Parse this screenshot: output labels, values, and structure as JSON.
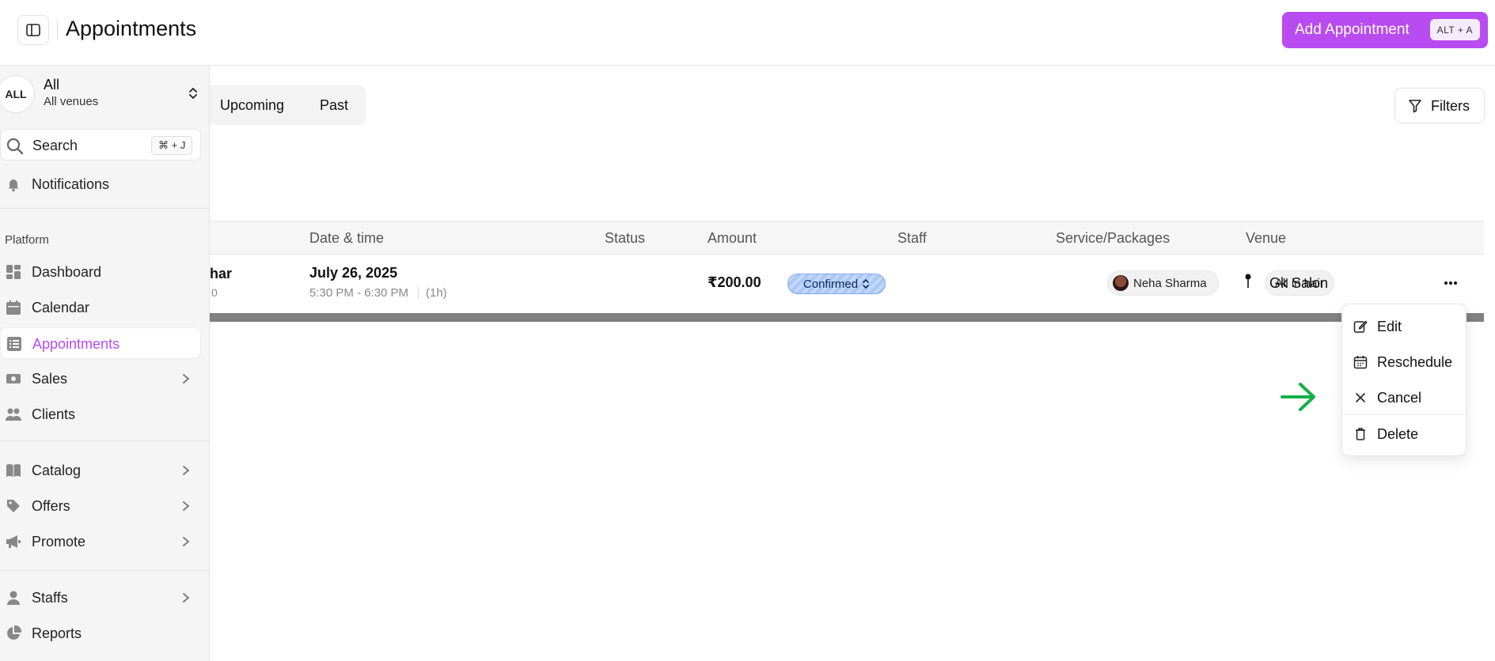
{
  "header": {
    "title": "Appointments",
    "add_button": "Add Appointment",
    "add_shortcut": "ALT + A"
  },
  "sidebar": {
    "venue": {
      "avatar": "ALL",
      "name": "All",
      "sub": "All venues"
    },
    "search": {
      "label": "Search",
      "shortcut": "⌘ + J"
    },
    "notifications": "Notifications",
    "section": "Platform",
    "items": [
      {
        "label": "Dashboard",
        "icon": "dashboard-icon"
      },
      {
        "label": "Calendar",
        "icon": "calendar-icon"
      },
      {
        "label": "Appointments",
        "icon": "appointments-icon",
        "active": true
      },
      {
        "label": "Sales",
        "icon": "cash-icon",
        "has_submenu": true
      },
      {
        "label": "Clients",
        "icon": "users-icon"
      },
      {
        "label": "Catalog",
        "icon": "book-icon",
        "has_submenu": true
      },
      {
        "label": "Offers",
        "icon": "tag-icon",
        "has_submenu": true
      },
      {
        "label": "Promote",
        "icon": "megaphone-icon",
        "has_submenu": true
      },
      {
        "label": "Staffs",
        "icon": "staff-icon",
        "has_submenu": true
      },
      {
        "label": "Reports",
        "icon": "chart-pie-icon"
      }
    ]
  },
  "tabs": [
    "Upcoming",
    "Past"
  ],
  "filters_button": "Filters",
  "table": {
    "columns": [
      "Date & time",
      "Status",
      "Amount",
      "Staff",
      "Service/Packages",
      "Venue"
    ],
    "row": {
      "client_name_partial": "har",
      "client_sub_partial": "0",
      "date": "July 26, 2025",
      "time": "5:30 PM - 6:30 PM",
      "duration": "(1h)",
      "status": "Confirmed",
      "amount": "₹200.00",
      "staff": "Neha Sharma",
      "service": "All in hair",
      "venue": "Gk Salon"
    }
  },
  "row_menu": {
    "items": [
      "Edit",
      "Reschedule",
      "Cancel",
      "Delete"
    ]
  },
  "colors": {
    "accent": "#b84cf0",
    "status_confirmed": "#a9c7f6",
    "arrow": "#12b04a"
  }
}
